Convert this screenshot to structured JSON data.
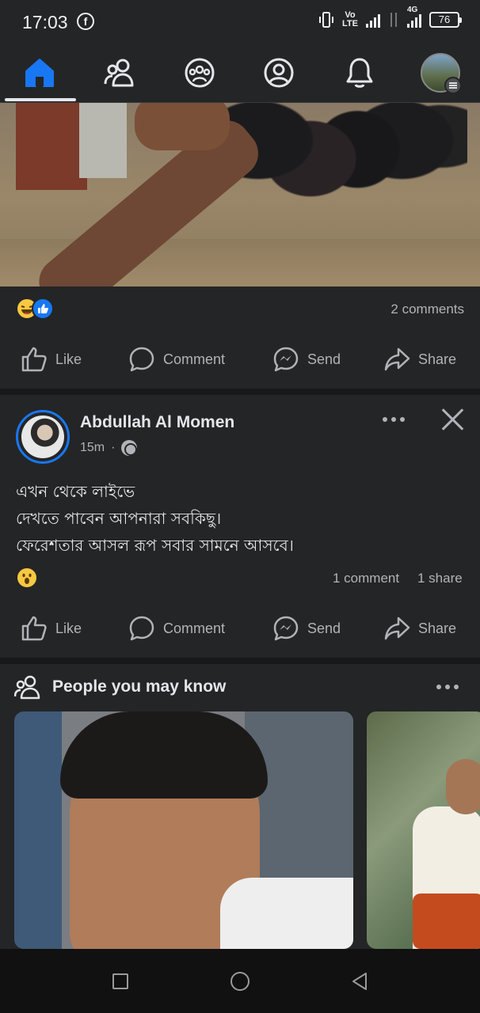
{
  "status_bar": {
    "time": "17:03",
    "network_label": "Vo\nLTE",
    "data_label": "4G",
    "battery": "76"
  },
  "nav": {
    "tabs": [
      {
        "id": "home",
        "icon": "home-icon",
        "active": true
      },
      {
        "id": "friends",
        "icon": "friends-icon"
      },
      {
        "id": "groups",
        "icon": "groups-icon"
      },
      {
        "id": "profile",
        "icon": "profile-icon"
      },
      {
        "id": "notifications",
        "icon": "bell-icon"
      },
      {
        "id": "menu",
        "icon": "avatar-menu"
      }
    ],
    "active_color": "#1877f2"
  },
  "post1": {
    "reactions": [
      "haha",
      "like"
    ],
    "comments": "2 comments",
    "actions": {
      "like": "Like",
      "comment": "Comment",
      "send": "Send",
      "share": "Share"
    }
  },
  "post2": {
    "author": "Abdullah Al Momen",
    "time": "15m",
    "privacy_icon": "globe-icon",
    "text_lines": [
      "এখন থেকে লাইভে",
      "দেখতে পাবেন আপনারা সবকিছু।",
      "ফেরেশতার আসল রূপ সবার সামনে আসবে।"
    ],
    "reactions": [
      "wow"
    ],
    "comments": "1 comment",
    "shares": "1 share",
    "actions": {
      "like": "Like",
      "comment": "Comment",
      "send": "Send",
      "share": "Share"
    }
  },
  "people_you_may_know": {
    "title": "People you may know"
  },
  "colors": {
    "background": "#18191a",
    "surface": "#242526",
    "text_primary": "#e4e6eb",
    "text_secondary": "#b0b3b8",
    "accent": "#1877f2"
  }
}
